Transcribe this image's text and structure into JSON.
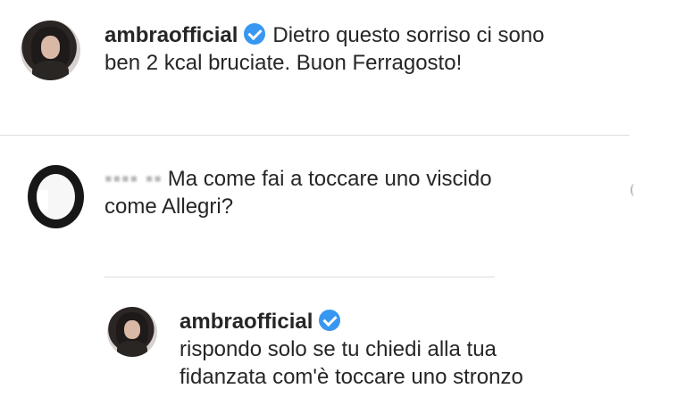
{
  "comments": [
    {
      "username": "ambraofficial",
      "verified": true,
      "text_line_1": "Dietro questo sorriso ci sono",
      "text_line_2": "ben 2 kcal bruciate. Buon Ferragosto!"
    },
    {
      "username": "",
      "username_visibility": "blurred",
      "text_line_1": "Ma come fai a toccare uno viscido",
      "text_line_2": "come Allegri?"
    },
    {
      "username": "ambraofficial",
      "verified": true,
      "text_line_1": "rispondo solo se tu chiedi alla tua",
      "text_line_2": "fidanzata com'è toccare uno stronzo"
    }
  ],
  "icons": {
    "verified_badge": "verified-badge-icon",
    "side_marker": "chevron-right-icon"
  },
  "colors": {
    "verified_badge": "#3897f0",
    "text": "#262626",
    "divider": "#dcdcdc"
  }
}
